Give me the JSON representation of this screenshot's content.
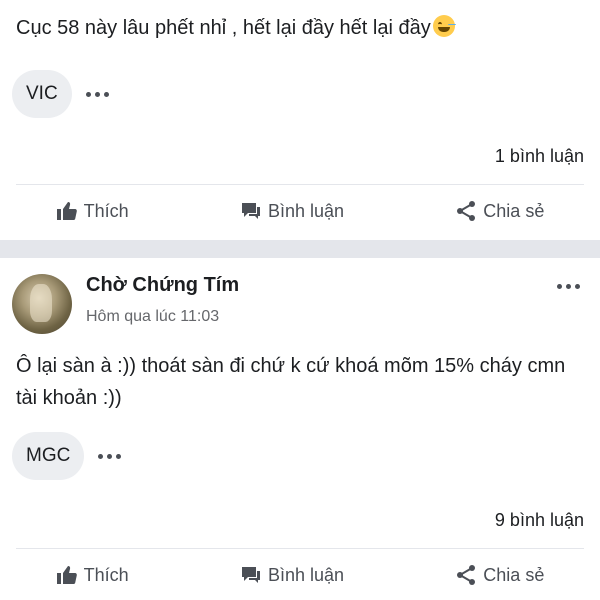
{
  "posts": [
    {
      "text": "Cục 58 này lâu phết nhỉ , hết lại đầy hết lại đầy",
      "emoji": "grinning-sweat-emoji",
      "tag": "VIC",
      "comment_count": "1 bình luận",
      "actions": {
        "like": "Thích",
        "comment": "Bình luận",
        "share": "Chia sẻ"
      }
    },
    {
      "author": "Chờ Chứng Tím",
      "timestamp": "Hôm qua lúc 11:03",
      "text": "Ô lại sàn à :)) thoát sàn đi chứ k cứ khoá mõm 15% cháy cmn tài khoản :))",
      "tag": "MGC",
      "comment_count": "9 bình luận",
      "actions": {
        "like": "Thích",
        "comment": "Bình luận",
        "share": "Chia sẻ"
      }
    }
  ],
  "colors": {
    "action_text": "#4b4f56",
    "separator": "#e4e6eb",
    "tag_bg": "#eceef1",
    "secondary_text": "#65676b"
  }
}
